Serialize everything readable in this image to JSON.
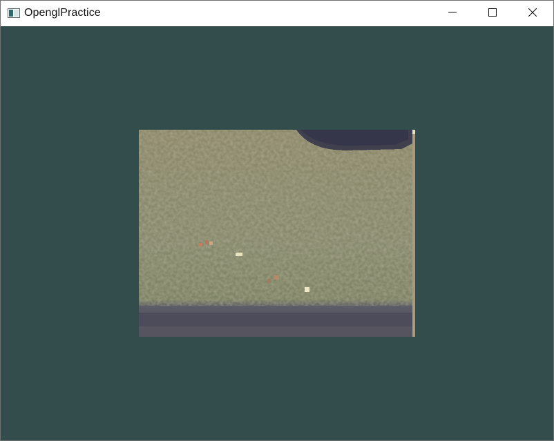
{
  "window": {
    "title": "OpenglPractice",
    "icons": {
      "app": "window-app-icon",
      "minimize": "minimize-icon",
      "maximize": "maximize-icon",
      "close": "close-icon"
    }
  },
  "viewport": {
    "clear_color": "#334d4d",
    "texture": {
      "description_colors": {
        "surface": "#8c8768",
        "shadow_top": "#3a3a48",
        "shadow_bottom": "#4a4a58",
        "speck_orange": "#c08060",
        "speck_light": "#e8e6c0"
      }
    }
  }
}
